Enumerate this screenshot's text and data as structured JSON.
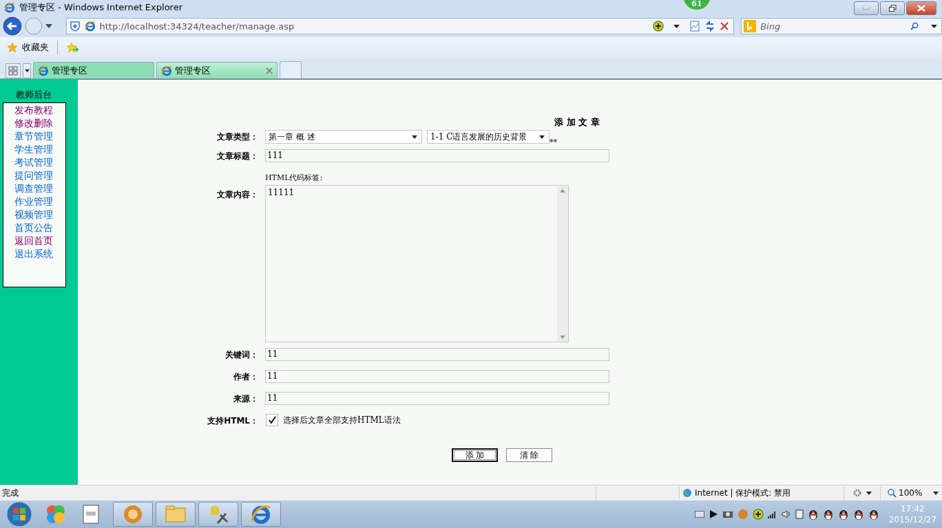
{
  "window": {
    "title": "管理专区 - Windows Internet Explorer"
  },
  "badge": "61",
  "address_bar": {
    "url": "http://localhost:34324/teacher/manage.asp"
  },
  "search": {
    "placeholder": "Bing"
  },
  "favorites_bar": {
    "label": "收藏夹"
  },
  "tabs": [
    {
      "label": "管理专区",
      "selected": false
    },
    {
      "label": "管理专区",
      "selected": true
    }
  ],
  "sidebar": {
    "title": "教师后台",
    "items": [
      {
        "label": "发布教程",
        "visited": true
      },
      {
        "label": "修改删除",
        "visited": true
      },
      {
        "label": "章节管理",
        "visited": false
      },
      {
        "label": "学生管理",
        "visited": false
      },
      {
        "label": "考试管理",
        "visited": false
      },
      {
        "label": "提问管理",
        "visited": false
      },
      {
        "label": "调查管理",
        "visited": false
      },
      {
        "label": "作业管理",
        "visited": false
      },
      {
        "label": "视频管理",
        "visited": false
      },
      {
        "label": "首页公告",
        "visited": false
      },
      {
        "label": "返回首页",
        "visited": true
      },
      {
        "label": "退出系统",
        "visited": false
      }
    ]
  },
  "form": {
    "title": "添 加 文 章",
    "fields": [
      {
        "kind": "selects",
        "label": "文章类型：",
        "options": [
          "第一章  概  述",
          "1-1 C语言发展的历史背景"
        ],
        "note": "**"
      },
      {
        "kind": "text",
        "label": "文章标题：",
        "value": "111"
      },
      {
        "kind": "textarea",
        "label": "文章内容：",
        "hint": "HTML代码标签:",
        "value": "11111"
      },
      {
        "kind": "text",
        "label": "关键词：",
        "value": "11"
      },
      {
        "kind": "text",
        "label": "作者：",
        "value": "11"
      },
      {
        "kind": "text",
        "label": "来源：",
        "value": "11"
      },
      {
        "kind": "checkbox",
        "label": "支持HTML：",
        "checked": true,
        "text": "选择后文章全部支持HTML语法"
      }
    ],
    "buttons": [
      {
        "label": "添 加",
        "focused": true
      },
      {
        "label": "清 除",
        "focused": false
      }
    ]
  },
  "status_bar": {
    "text": "完成",
    "zone": "Internet | 保护模式: 禁用",
    "zoom": "100%"
  },
  "taskbar": {
    "time": "17:42",
    "date": "2015/12/27"
  }
}
